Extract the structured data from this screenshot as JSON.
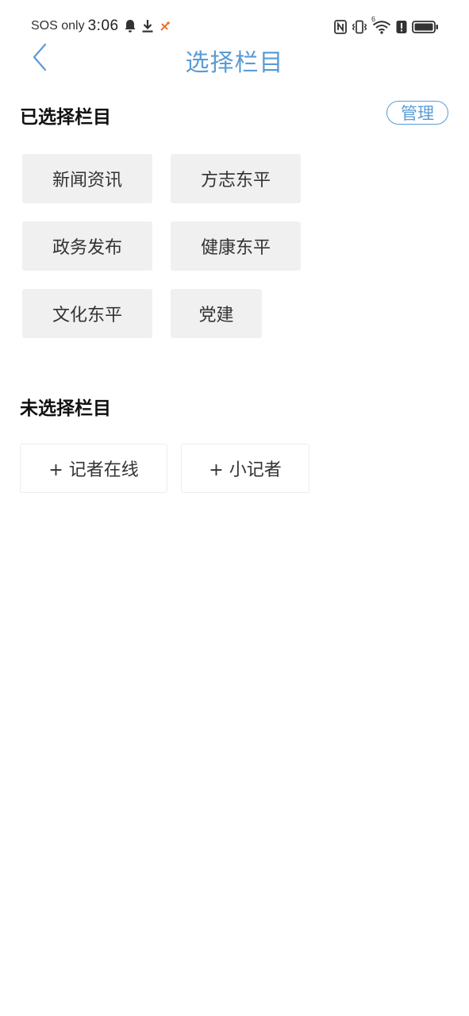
{
  "status_bar": {
    "carrier": "SOS only",
    "time": "3:06",
    "left_icons": [
      "bell-icon",
      "download-icon",
      "app-notification-icon"
    ],
    "right_icons": [
      "nfc-icon",
      "vibrate-icon",
      "wifi-icon",
      "alert-icon",
      "battery-icon"
    ],
    "wifi_badge": "6"
  },
  "header": {
    "title": "选择栏目",
    "accent_color": "#5b9bd5"
  },
  "selected_section": {
    "title": "已选择栏目",
    "manage_label": "管理",
    "items": [
      {
        "label": "新闻资讯"
      },
      {
        "label": "方志东平"
      },
      {
        "label": "政务发布"
      },
      {
        "label": "健康东平"
      },
      {
        "label": "文化东平"
      },
      {
        "label": "党建"
      }
    ]
  },
  "unselected_section": {
    "title": "未选择栏目",
    "items": [
      {
        "label": "+ 记者在线"
      },
      {
        "label": "+ 小记者"
      }
    ]
  }
}
